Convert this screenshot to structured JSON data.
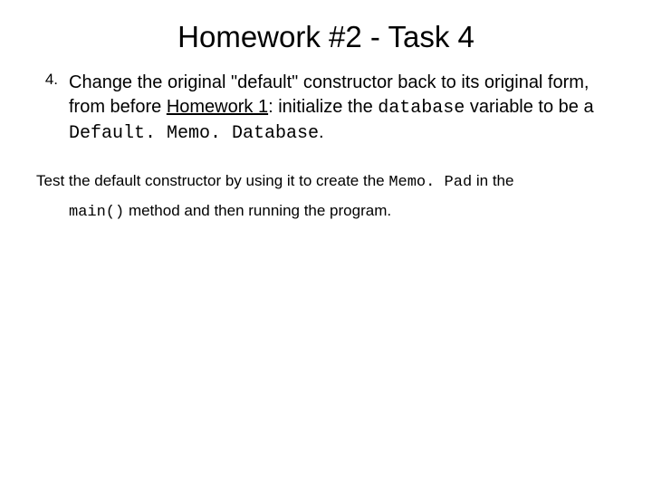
{
  "title": "Homework #2 - Task 4",
  "item": {
    "number": "4.",
    "text_before_link": "Change the original \"default\" constructor back to its original form, from before ",
    "link_text": "Homework 1",
    "text_after_link": ": initialize the ",
    "code1": "database",
    "text_mid": " variable to be a ",
    "code2": "Default. Memo. Database",
    "text_end": "."
  },
  "test": {
    "t1": "Test the default constructor by using it to create the ",
    "code1": "Memo. Pad",
    "t2": " in the ",
    "code2": "main()",
    "t3": " method and then running the program."
  }
}
